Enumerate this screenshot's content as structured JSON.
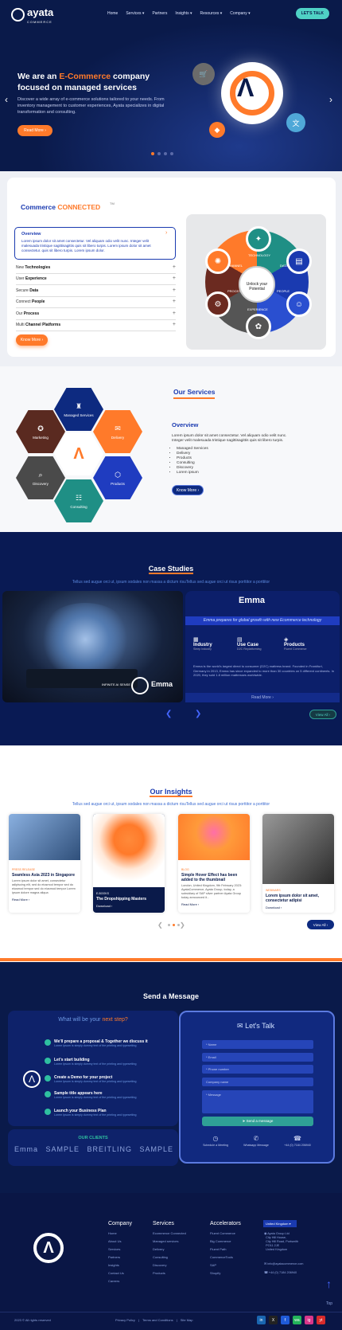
{
  "nav": {
    "logo_text": "ayata",
    "logo_sub": "COMMERCE",
    "items": [
      "Home",
      "Services",
      "Partners",
      "Insights",
      "Resources",
      "Company"
    ],
    "cta": "LET'S TALK"
  },
  "hero": {
    "title_pre": "We are an ",
    "title_hl": "E-Commerce",
    "title_post": " company focused on managed services",
    "desc": "Discover a wide array of e-commerce solutions tailored to your needs. From inventory management to customer experiences, Ayata specializes in digital transformation and consulting.",
    "button": "Read More",
    "slides_total": 4,
    "slide_active": 1
  },
  "connected": {
    "title_a": "Commerce",
    "title_b": "CONNECTED",
    "tm": "TM",
    "overview_title": "Overview",
    "overview_text": "Lorem ipsum dolor sit amet consectetur. Vel aliquam odio velit nunc. Integer velit malesuada tristique sagittisagittis quis sit libero turpis. Lorem ipsum dolor sit amet consectetur. quis sit libero turpis. Lorem ipsum dolor.",
    "items": [
      {
        "pre": "New ",
        "bold": "Technologies"
      },
      {
        "pre": "User ",
        "bold": "Experience"
      },
      {
        "pre": "Secure ",
        "bold": "Data"
      },
      {
        "pre": "Connect ",
        "bold": "People"
      },
      {
        "pre": "Our ",
        "bold": "Process"
      },
      {
        "pre": "Multi ",
        "bold": "Channel Platforms"
      }
    ],
    "button": "Know More",
    "wheel_center": "Unlock your Potential",
    "wheel_labels": [
      "TECHNOLOGY",
      "DATA",
      "PEOPLE",
      "EXPERIENCE",
      "PROCESS",
      "CHANNEL"
    ]
  },
  "services": {
    "title": "Our Services",
    "hexes": [
      "Managed Services",
      "Marketing",
      "Delivery",
      "Discovery",
      "Products",
      "Consulting"
    ],
    "overview_title": "Overview",
    "overview_text": "Lorem ipsum dolor sit amet consectetur. Vel aliquam odio velit nunc. Integer velit malesuada tristique sagittisagittis quis sit libero turpis.",
    "list": [
      "Managed Services",
      "Delivery",
      "Products",
      "Consulting",
      "Discovery",
      "Lorem ipsum"
    ],
    "button": "Know More"
  },
  "case_studies": {
    "title": "Case Studies",
    "subtitle": "Tellus sed augue orci ut, ipsum sodales non massa a dictum risuTellus sed augue orci ut risus porttitor a porttitor",
    "brand": "Emma",
    "banner": "Emma prepares for global growth with new Ecommerce technology",
    "cols": [
      {
        "title": "Industry",
        "sub": "Sleep Industry"
      },
      {
        "title": "Use Case",
        "sub": "D2C Replatforming"
      },
      {
        "title": "Products",
        "sub": "Fluent Commerce"
      }
    ],
    "text": "Emma is the world's largest direct to consumer (D2C) mattress brand. Founded in Frankfurt, Germany in 2013, Emma has since expanded to more than 30 countries on 5 different continents. In 2020, they sold 1.8 million mattresses worldwide.",
    "read_more": "Read More",
    "view_all": "View All",
    "image_caption": "INFINITE AI SENSE"
  },
  "insights": {
    "title": "Our Insights",
    "subtitle": "Tellus sed augue orci ut, ipsum sodales non massa a dictum risuTellus sed augue orci ut risus porttitor a porttitor",
    "cards": [
      {
        "tag": "PRESS RELEASE",
        "title": "Seamless Asia 2023 in Singapore",
        "desc": "Lorem ipsum dolor sit amet, consectetur adipiscing elit, sed do eiusmod tempor sed do eiusmod tempor sed do eiusmod tempor Lorem ipsum dolore magna aliqua",
        "link": "Read More"
      },
      {
        "tag": "E-BOOKS",
        "title": "The Dropshipping Masters",
        "desc": "",
        "link": "Download"
      },
      {
        "tag": "BLOG",
        "title": "Simple Hover Effect has been added to the thumbnail",
        "desc": "London, United Kingdom, 9th February 2023: AyataCommerce, Ayata Group, today, a subsidiary of SAP silver partner Ayata Group today announced it...",
        "link": "Read More"
      },
      {
        "tag": "WEBINARS",
        "title": "Lorem ipsum dolor sit amet, consectetur adipisi",
        "desc": "",
        "link": "Download"
      }
    ],
    "view_all": "View All"
  },
  "contact": {
    "title": "Send a Message",
    "steps_heading_a": "What will be your ",
    "steps_heading_b": "next step?",
    "steps": [
      {
        "title": "We'll prepare a proposal & Together we discuss it",
        "sub": "Lorem Ipsum is simply dummy text of the printing and typesetting"
      },
      {
        "title": "Let's start building",
        "sub": "Lorem Ipsum is simply dummy text of the printing and typesetting"
      },
      {
        "title": "Create a Demo for your project",
        "sub": "Lorem Ipsum is simply dummy text of the printing and typesetting"
      },
      {
        "title": "Sample title appears here",
        "sub": "Lorem Ipsum is simply dummy text of the printing and typesetting"
      },
      {
        "title": "Launch your Business Plan",
        "sub": "Lorem Ipsum is simply dummy text of the printing and typesetting"
      }
    ],
    "clients_title": "OUR CLIENTS",
    "clients": [
      "Emma",
      "SAMPLE",
      "BREITLING",
      "SAMPLE"
    ],
    "form_title": "Let's Talk",
    "fields": [
      "Name",
      "Email",
      "Phone number",
      "Company name",
      "Message"
    ],
    "send": "Send a message",
    "contact_options": [
      "Schedule a Meeting",
      "Whatsapp Message",
      "+44 (0) 7184 206940"
    ]
  },
  "footer": {
    "company": {
      "title": "Company",
      "links": [
        "Home",
        "About Us",
        "Services",
        "Partners",
        "Insights",
        "Contact Us",
        "Careers"
      ]
    },
    "services": {
      "title": "Services",
      "links": [
        "Ecommerce Connected",
        "Managed services",
        "Delivery",
        "Consulting",
        "Discovery",
        "Products"
      ]
    },
    "accelerators": {
      "title": "Accelerators",
      "links": [
        "Fluent Commerce",
        "Big Commerce",
        "Fluent Path",
        "CommerceTools",
        "SAP",
        "Shopify"
      ]
    },
    "region": "United Kingdom",
    "address": [
      "Ayata Group Ltd",
      "City Hill House,",
      "City Hill Road, Portsmith",
      "PO11 2JE",
      "United Kingdom"
    ],
    "email": "info@ayatacommerce.com",
    "phone": "+44 (0) 7184 206940",
    "top": "Top",
    "copyright": "2023 © All rights reserved",
    "legal": [
      "Privacy Policy",
      "Terms and Conditions",
      "Site Map"
    ],
    "social": [
      "in",
      "X",
      "f",
      "wa",
      "ig",
      "yt"
    ]
  },
  "colors": {
    "brand_blue": "#0a1a4a",
    "accent_orange": "#ff7a2a",
    "teal": "#4fd1c5"
  }
}
